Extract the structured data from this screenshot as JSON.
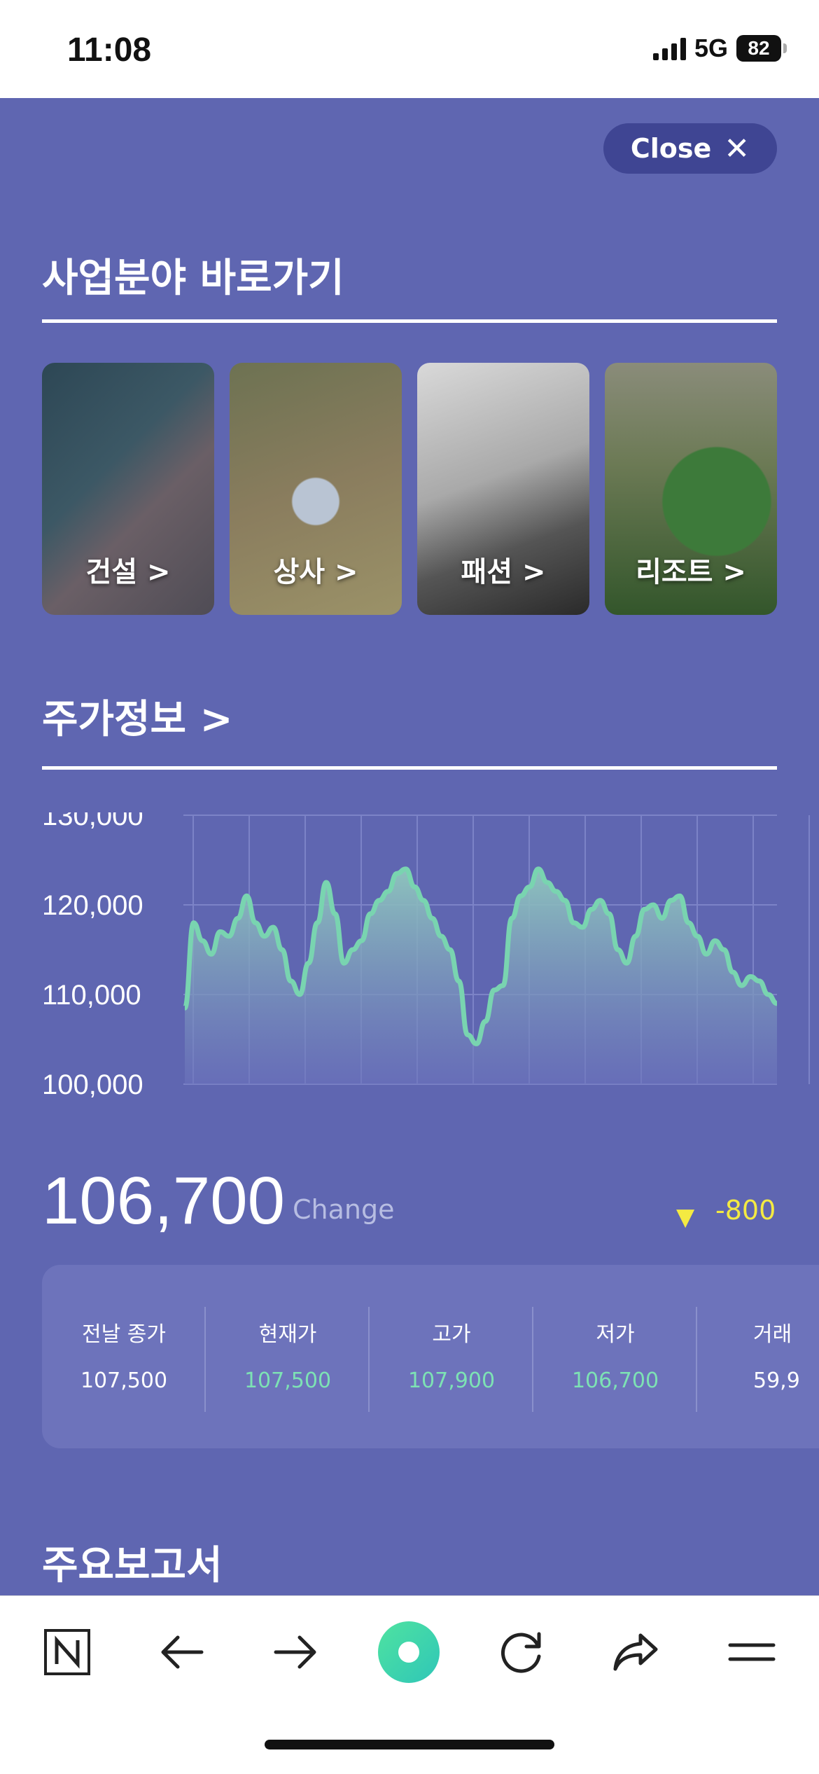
{
  "status_bar": {
    "time": "11:08",
    "network": "5G",
    "battery": "82"
  },
  "close_button": {
    "label": "Close"
  },
  "business": {
    "title": "사업분야 바로가기",
    "tiles": [
      {
        "label": "건설 >"
      },
      {
        "label": "상사 >"
      },
      {
        "label": "패션 >"
      },
      {
        "label": "리조트 >"
      }
    ]
  },
  "stock": {
    "title": "주가정보 >",
    "price": "106,700",
    "change_label": "Change",
    "change_arrow": "▼",
    "change_value": "-800",
    "stats": [
      {
        "label": "전날 종가",
        "value": "107,500"
      },
      {
        "label": "현재가",
        "value": "107,500"
      },
      {
        "label": "고가",
        "value": "107,900"
      },
      {
        "label": "저가",
        "value": "106,700"
      },
      {
        "label": "거래",
        "value": "59,9"
      }
    ]
  },
  "reports": {
    "title": "주요보고서"
  },
  "chart_data": {
    "type": "area",
    "y_tick_labels": [
      "130,000",
      "120,000",
      "110,000",
      "100,000"
    ],
    "ylim": [
      100000,
      130000
    ],
    "grid": true,
    "values": [
      108500,
      118000,
      116000,
      114500,
      117000,
      116500,
      118500,
      121000,
      118000,
      116500,
      117500,
      115000,
      111500,
      110000,
      113500,
      118000,
      122500,
      119000,
      113500,
      115000,
      116000,
      119000,
      120500,
      121500,
      123500,
      124000,
      122000,
      120500,
      118500,
      116500,
      115000,
      111500,
      105500,
      104500,
      107000,
      110500,
      111000,
      118500,
      121000,
      122000,
      124000,
      122500,
      121500,
      120500,
      118000,
      117500,
      119500,
      120500,
      119000,
      115000,
      113500,
      116500,
      119500,
      120000,
      118500,
      120500,
      121000,
      118000,
      116500,
      114500,
      116000,
      115000,
      112500,
      111000,
      112000,
      111500,
      110000,
      109000
    ],
    "colors": {
      "line": "#79d4b0",
      "fill_top": "#8fc7bd",
      "fill_bottom": "#6c73bc",
      "grid": "#7c83c7"
    }
  },
  "nav": {
    "icons": [
      "n-logo-icon",
      "back-arrow-icon",
      "forward-arrow-icon",
      "home-circle-icon",
      "refresh-icon",
      "share-icon",
      "menu-icon"
    ]
  },
  "colors": {
    "background": "#5f66b1",
    "accent_green": "#7de2b4",
    "change_down": "#f4ea42"
  }
}
